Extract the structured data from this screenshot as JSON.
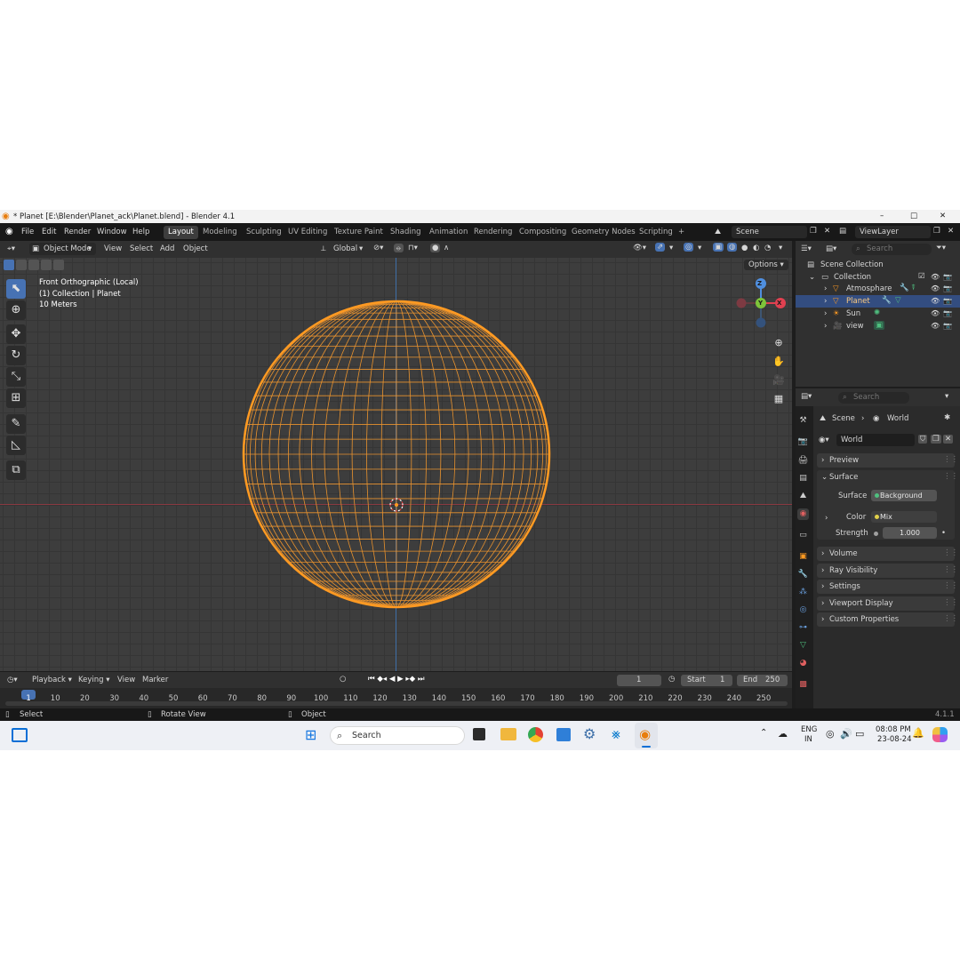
{
  "window": {
    "title": "* Planet [E:\\Blender\\Planet_ack\\Planet.blend] - Blender 4.1",
    "minimize": "–",
    "maximize": "□",
    "close": "✕"
  },
  "menu": [
    "File",
    "Edit",
    "Render",
    "Window",
    "Help"
  ],
  "workspaces": [
    "Layout",
    "Modeling",
    "Sculpting",
    "UV Editing",
    "Texture Paint",
    "Shading",
    "Animation",
    "Rendering",
    "Compositing",
    "Geometry Nodes",
    "Scripting"
  ],
  "add_workspace": "+",
  "scene_name": "Scene",
  "view_layer": "ViewLayer",
  "viewport_header": {
    "mode": "Object Mode",
    "menus": [
      "View",
      "Select",
      "Add",
      "Object"
    ],
    "orientation": "Global",
    "options": "Options"
  },
  "viewport": {
    "view_name": "Front Orthographic (Local)",
    "collection_info": "(1) Collection | Planet",
    "scale": "10 Meters",
    "gizmo": {
      "z": "Z",
      "y": "Y",
      "x": "X"
    }
  },
  "outliner": {
    "search_placeholder": "Search",
    "root": "Scene Collection",
    "collection": "Collection",
    "items": [
      "Atmosphare",
      "Planet",
      "Sun",
      "view"
    ]
  },
  "properties": {
    "search_placeholder": "Search",
    "breadcrumb_scene": "Scene",
    "breadcrumb_world": "World",
    "world_name": "World",
    "preview": "Preview",
    "surface_section": "Surface",
    "surface_label": "Surface",
    "surface_value": "Background",
    "color_label": "Color",
    "color_value": "Mix",
    "strength_label": "Strength",
    "strength_value": "1.000",
    "sections": [
      "Volume",
      "Ray Visibility",
      "Settings",
      "Viewport Display",
      "Custom Properties"
    ]
  },
  "timeline": {
    "menus": [
      "Playback",
      "Keying",
      "View",
      "Marker"
    ],
    "current_frame": "1",
    "start_label": "Start",
    "start_value": "1",
    "end_label": "End",
    "end_value": "250",
    "ticks": [
      "1",
      "10",
      "20",
      "30",
      "40",
      "50",
      "60",
      "70",
      "80",
      "90",
      "100",
      "110",
      "120",
      "130",
      "140",
      "150",
      "160",
      "170",
      "180",
      "190",
      "200",
      "210",
      "220",
      "230",
      "240",
      "250"
    ]
  },
  "statusbar": {
    "select": "Select",
    "rotate": "Rotate View",
    "object": "Object",
    "version": "4.1.1"
  },
  "taskbar": {
    "search": "Search",
    "lang_line1": "ENG",
    "lang_line2": "IN",
    "time": "08:08 PM",
    "date": "23-08-24"
  },
  "colors": {
    "accent": "#4772b3",
    "selection": "#ff9a22",
    "wire": "#e8922e",
    "background": "#3d3d3d"
  }
}
